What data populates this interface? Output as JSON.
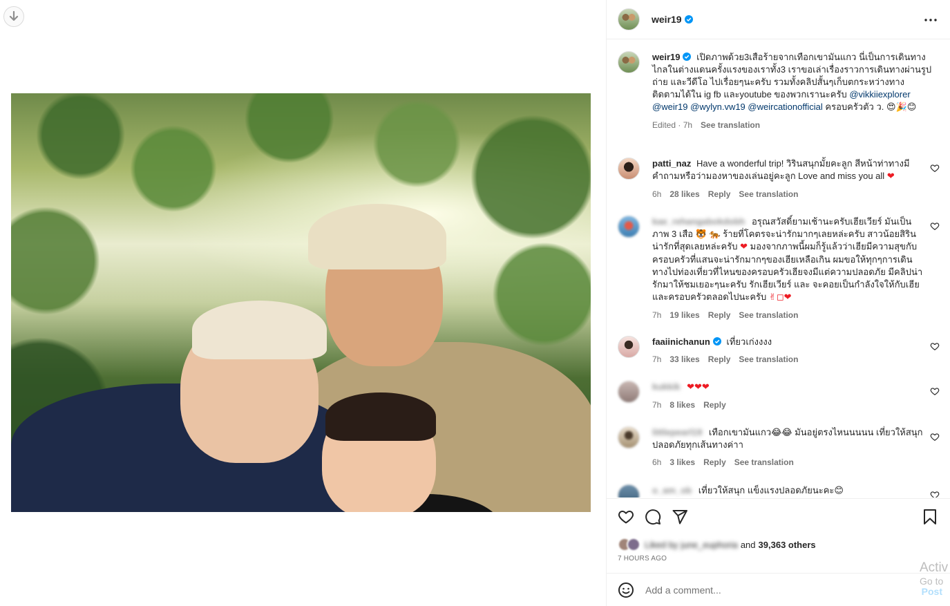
{
  "colors": {
    "accent": "#0095f6",
    "link": "#00376b",
    "heart": "#ed1c24",
    "muted": "#737373",
    "border": "#efefef"
  },
  "header": {
    "username": "weir19",
    "verified": true
  },
  "caption": {
    "username": "weir19",
    "text_1": "เปิดภาพด้วย3เสือร้ายจากเทือกเขามันแกว นี่เป็นการเดินทางไกลในต่างแดนครั้งแรงของเราทั้ง3 เราขอเล่าเรื่องราวการเดินทางผ่านรูปถ่าย และวีดีโอ ไปเรื่อยๆนะครับ รวมทั้งคลิปสั้นๆเก็บตกระหว่างทาง ติดตามได้ใน ig fb และyoutube ของพวกเรานะครับ",
    "mention_1": "@vikkiiexplorer",
    "mention_2": "@weir19",
    "mention_3": "@wylyn.vw19",
    "mention_4": "@weircationofficial",
    "text_2": "ครอบครัวตัว ว.",
    "emojis": "😍🎉😊",
    "edited": "Edited · 7h",
    "translation": "See translation"
  },
  "comments": [
    {
      "username": "patti_naz",
      "blurred": false,
      "verified": false,
      "text": "Have a wonderful trip! วิรินสนุกมั้ยคะลูก สีหน้าท่าทางมีคำถามหรือว่ามองหาของเล่นอยู่คะลูก Love and miss you all",
      "emoji": "❤",
      "time": "6h",
      "likes": "28 likes",
      "reply": "Reply",
      "translation": "See translation"
    },
    {
      "username": "kae_rehangabokdobh",
      "blurred": true,
      "verified": false,
      "text": "อรุณสวัสดิ์ยามเช้านะครับเฮียเวียร์ มันเป็นภาพ 3 เสือ 🐯 🐅 ร้ายที่โคตรจะน่ารักมากๆเลยหล่ะครับ สาวน้อยสิรินน่ารักที่สุดเลยหล่ะครับ",
      "text_b": "มองจากภาพนี้ผมก็รู้แล้วว่าเฮียมีความสุขกับครอบครัวที่แสนจะน่ารักมากๆของเฮียเหลือเกิน ผมขอให้ทุกๆการเดินทางไปท่องเที่ยวที่ไหนของครอบครัวเฮียจงมีแต่ความปลอดภัย มีคลิปน่ารักมาให้ชมเยอะๆนะครับ รักเฮียเวียร์ และ จะคอยเป็นกำลังใจให้กับเฮียและครอบครัวตลอดไปนะครับ",
      "emoji": "❤",
      "emoji_end": "✌◻❤",
      "time": "7h",
      "likes": "19 likes",
      "reply": "Reply",
      "translation": "See translation"
    },
    {
      "username": "faaiinichanun",
      "blurred": false,
      "verified": true,
      "text": "เที่ยวเก่งงงง",
      "time": "7h",
      "likes": "33 likes",
      "reply": "Reply",
      "translation": "See translation"
    },
    {
      "username": "kukkik",
      "blurred": true,
      "verified": false,
      "text": "❤❤❤",
      "time": "7h",
      "likes": "8 likes",
      "reply": "Reply"
    },
    {
      "username": "littlepearl19",
      "blurred": true,
      "verified": false,
      "text": "เทือกเขามันแกว😂😂 มันอยู่ตรงไหนนนนน เที่ยวให้สนุกปลอดภัยทุกเส้นทางค่าา",
      "time": "6h",
      "likes": "3 likes",
      "reply": "Reply",
      "translation": "See translation"
    },
    {
      "username": "o_am_ob",
      "blurred": true,
      "verified": false,
      "text": "เที่ยวให้สนุก แข็งแรงปลอดภัยนะคะ😊"
    }
  ],
  "likes": {
    "liked_by": "Liked by",
    "name": "june_euphoria",
    "and": "and",
    "count": "39,363 others"
  },
  "time_ago": "7 hours ago",
  "comment_box": {
    "placeholder": "Add a comment...",
    "post": "Post"
  },
  "watermark": {
    "line1": "Activ",
    "line2": "Go to"
  }
}
